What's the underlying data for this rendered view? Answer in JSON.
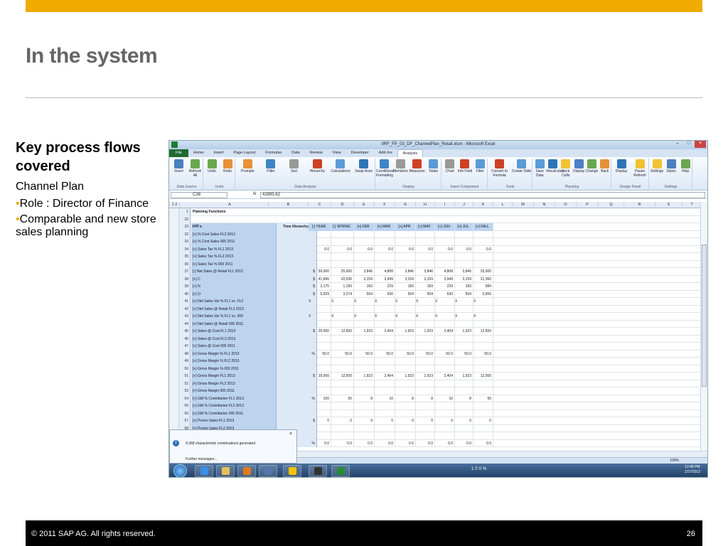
{
  "slide": {
    "title": "In the system",
    "side_heading": "Key process flows covered",
    "side_sub": "Channel Plan",
    "bullets": [
      "Role : Director of Finance",
      "Comparable and new store sales planning"
    ],
    "bullet_glyph": "•",
    "footer_copy": "© 2011 SAP AG. All rights reserved.",
    "page_number": "26",
    "accent": "#f0ab00"
  },
  "excel": {
    "window_title": "0RF_FP_03_DF_ChannelPlan_Retail.xlsm - Microsoft Excel",
    "tabs": [
      "File",
      "Home",
      "Insert",
      "Page Layout",
      "Formulas",
      "Data",
      "Review",
      "View",
      "Developer",
      "Add-Ins",
      "Analysis"
    ],
    "active_tab": "Analysis",
    "ribbon_groups": [
      {
        "label": "Data Source",
        "buttons": [
          "Insert",
          "Refresh All"
        ]
      },
      {
        "label": "Undo",
        "buttons": [
          "Undo",
          "Redo"
        ]
      },
      {
        "label": "Data Analysis",
        "buttons": [
          "Prompts",
          "Filter",
          "Sort",
          "Hierarchy",
          "Calculations",
          "Swap Axes"
        ]
      },
      {
        "label": "Display",
        "buttons": [
          "Conditional Formatting",
          "Members",
          "Measures",
          "Totals"
        ]
      },
      {
        "label": "Insert Component",
        "buttons": [
          "Chart",
          "Info Field",
          "Filter"
        ]
      },
      {
        "label": "Tools",
        "buttons": [
          "Convert to Formula",
          "Create Slide"
        ]
      },
      {
        "label": "Planning",
        "buttons": [
          "Save Data",
          "Recalculate",
          "Lock Cells",
          "Display",
          "Change",
          "Back"
        ]
      },
      {
        "label": "Design Panel",
        "buttons": [
          "Display",
          "Pause Refresh"
        ]
      },
      {
        "label": "Settings",
        "buttons": [
          "Settings",
          "Styles",
          "Help"
        ]
      }
    ],
    "name_box": "C38",
    "fx": "fx",
    "formula_value": "41895.62",
    "columns": [
      "A",
      "B",
      "C",
      "D",
      "E",
      "F",
      "G",
      "H",
      "I",
      "J",
      "K",
      "L",
      "M",
      "N",
      "O",
      "P",
      "Q",
      "R",
      "S",
      "T"
    ],
    "outline_levels": [
      "1",
      "2"
    ],
    "header_rows": [
      {
        "num": "1",
        "label": "Planning Functions"
      },
      {
        "num": "22",
        "label": ""
      }
    ],
    "table_header": {
      "num": "23",
      "kpi": "KPI´s",
      "time": "Time Hierarchy",
      "periods": [
        "[-] YEAR",
        "[-] SPRING",
        "[+] FEB",
        "[+] MAR",
        "[+] APR",
        "[+] MAY",
        "[+] JUN",
        "[+] JUL",
        "[+] FALL"
      ]
    },
    "rows": [
      {
        "num": "32",
        "label": "[+] % Cont Sales FL2 2013",
        "unit": "",
        "v": []
      },
      {
        "num": "33",
        "label": "[+] % Cont Sales 000 2011",
        "unit": "",
        "v": []
      },
      {
        "num": "34",
        "label": "[+] Sales Tax % FL1 2013",
        "unit": "",
        "v": [
          "0.0",
          "0.0",
          "0.0",
          "0.0",
          "0.0",
          "0.0",
          "0.0",
          "0.0",
          "0.0"
        ]
      },
      {
        "num": "35",
        "label": "[+] Sales Tax % FL2 2013",
        "unit": "",
        "v": []
      },
      {
        "num": "36",
        "label": "[+] Sales Tax % 000 2011",
        "unit": "",
        "v": []
      },
      {
        "num": "37",
        "label": "[-] Net Sales @ Retail FL1 2013",
        "unit": "$",
        "v": [
          "50,000",
          "25,000",
          "3,846",
          "4,808",
          "3,846",
          "3,846",
          "4,808",
          "3,846",
          "25,000"
        ]
      },
      {
        "num": "38",
        "label": "   [+] C",
        "unit": "$",
        "v": [
          "41,896",
          "20,536",
          "3,159",
          "3,949",
          "3,159",
          "3,159",
          "3,949",
          "3,159",
          "21,360"
        ]
      },
      {
        "num": "39",
        "label": "   [+] N",
        "unit": "$",
        "v": [
          "2,175",
          "1,190",
          "183",
          "229",
          "183",
          "183",
          "229",
          "183",
          "984"
        ]
      },
      {
        "num": "40",
        "label": "   [+] O",
        "unit": "$",
        "v": [
          "5,929",
          "3,274",
          "504",
          "630",
          "504",
          "504",
          "630",
          "504",
          "2,656"
        ]
      },
      {
        "num": "41",
        "label": "[+] Net Sales Var % FL1 vs. FL2",
        "unit": "",
        "v": [
          "X",
          "X",
          "X",
          "X",
          "X",
          "X",
          "X",
          "X",
          "X"
        ]
      },
      {
        "num": "42",
        "label": "[+] Net Sales @ Retail FL2 2013",
        "unit": "",
        "v": []
      },
      {
        "num": "43",
        "label": "[+] Net Sales Var % FL1 vs. 000",
        "unit": "",
        "v": [
          "X",
          "X",
          "X",
          "X",
          "X",
          "X",
          "X",
          "X",
          "X"
        ]
      },
      {
        "num": "44",
        "label": "[+] Net Sales @ Retail 000 2011",
        "unit": "",
        "v": []
      },
      {
        "num": "45",
        "label": "[+] Sales @ Cost FL1 2013",
        "unit": "$",
        "v": [
          "25,000",
          "12,500",
          "1,923",
          "2,404",
          "1,923",
          "1,923",
          "2,404",
          "1,923",
          "12,500"
        ]
      },
      {
        "num": "46",
        "label": "[+] Sales @ Cost FL2  2013",
        "unit": "",
        "v": []
      },
      {
        "num": "47",
        "label": "[+] Sales @ Cost 000 2011",
        "unit": "",
        "v": []
      },
      {
        "num": "48",
        "label": "[+] Gross Margin % FL1 2013",
        "unit": "%",
        "v": [
          "50.0",
          "50.0",
          "50.0",
          "50.0",
          "50.0",
          "50.0",
          "50.0",
          "50.0",
          "50.0"
        ]
      },
      {
        "num": "49",
        "label": "[+] Gross Margin % FL2  2013",
        "unit": "",
        "v": []
      },
      {
        "num": "50",
        "label": "[+] Gross Margin % 000 2011",
        "unit": "",
        "v": []
      },
      {
        "num": "51",
        "label": "[+] Gross Margin FL1 2013",
        "unit": "$",
        "v": [
          "25,000",
          "12,500",
          "1,923",
          "2,404",
          "1,923",
          "1,923",
          "2,404",
          "1,923",
          "12,500"
        ]
      },
      {
        "num": "52",
        "label": "[+] Gross Margin FL2 2013",
        "unit": "",
        "v": []
      },
      {
        "num": "53",
        "label": "[+] Gross Margin 000 2011",
        "unit": "",
        "v": []
      },
      {
        "num": "54",
        "label": "[+] GM % Contribution FL1 2013",
        "unit": "%",
        "v": [
          "100",
          "50",
          "8",
          "10",
          "8",
          "8",
          "10",
          "8",
          "50"
        ]
      },
      {
        "num": "55",
        "label": "[+] GM % Contribution FL2 2013",
        "unit": "",
        "v": []
      },
      {
        "num": "56",
        "label": "[+] GM % Contribution 000 2011",
        "unit": "",
        "v": []
      },
      {
        "num": "57",
        "label": "[+] Promo Sales FL1 2013",
        "unit": "$",
        "v": [
          "0",
          "0",
          "0",
          "0",
          "0",
          "0",
          "0",
          "0",
          "0"
        ]
      },
      {
        "num": "58",
        "label": "[+] Promo Sales FL2 2013",
        "unit": "",
        "v": []
      },
      {
        "num": "",
        "label": "",
        "unit": "",
        "v": []
      },
      {
        "num": "",
        "label": "",
        "unit": "%",
        "v": [
          "0.0",
          "0.0",
          "0.0",
          "0.0",
          "0.0",
          "0.0",
          "0.0",
          "0.0",
          "0.0"
        ]
      }
    ],
    "popup": {
      "message": "4,368 characteristic combinations generated",
      "more": "Further messages...",
      "close": "×",
      "info": "i"
    },
    "status": {
      "zoom": "100%"
    },
    "taskbar": {
      "time": "12:48 PM",
      "date": "1/27/2012",
      "battery": "100%"
    }
  }
}
